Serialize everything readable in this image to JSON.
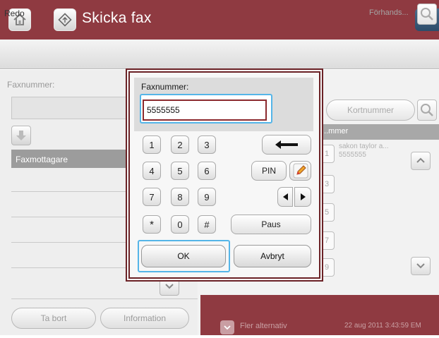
{
  "header": {
    "title": "Skicka fax",
    "home_icon": "home-icon",
    "app_icon": "send-fax-icon",
    "help_label": "?"
  },
  "status": {
    "text": "Redo",
    "preview_label": "Förhands..."
  },
  "left_panel": {
    "fax_number_label": "Faxnummer:",
    "recipients_header": "Faxmottagare",
    "remove_button": "Ta bort",
    "info_button": "Information"
  },
  "right_panel": {
    "shortcut_button": "Kortnummer",
    "contacts_header": "...mmer",
    "contact_name": "sakon taylor a...",
    "contact_number": "5555555",
    "row_tabs": [
      "1",
      "3",
      "5",
      "7",
      "9"
    ],
    "more_options": "Fler alternativ",
    "datetime": "22 aug 2011 3:43:59 EM"
  },
  "dialog": {
    "label": "Faxnummer:",
    "value": "5555555",
    "keys": [
      "1",
      "2",
      "3",
      "4",
      "5",
      "6",
      "7",
      "8",
      "9",
      "*",
      "0",
      "#"
    ],
    "pin_label": "PIN",
    "pause_label": "Paus",
    "ok_label": "OK",
    "cancel_label": "Avbryt"
  },
  "colors": {
    "brand": "#8f3a41",
    "dialog_border": "#6b2226",
    "focus": "#55b5e8"
  }
}
